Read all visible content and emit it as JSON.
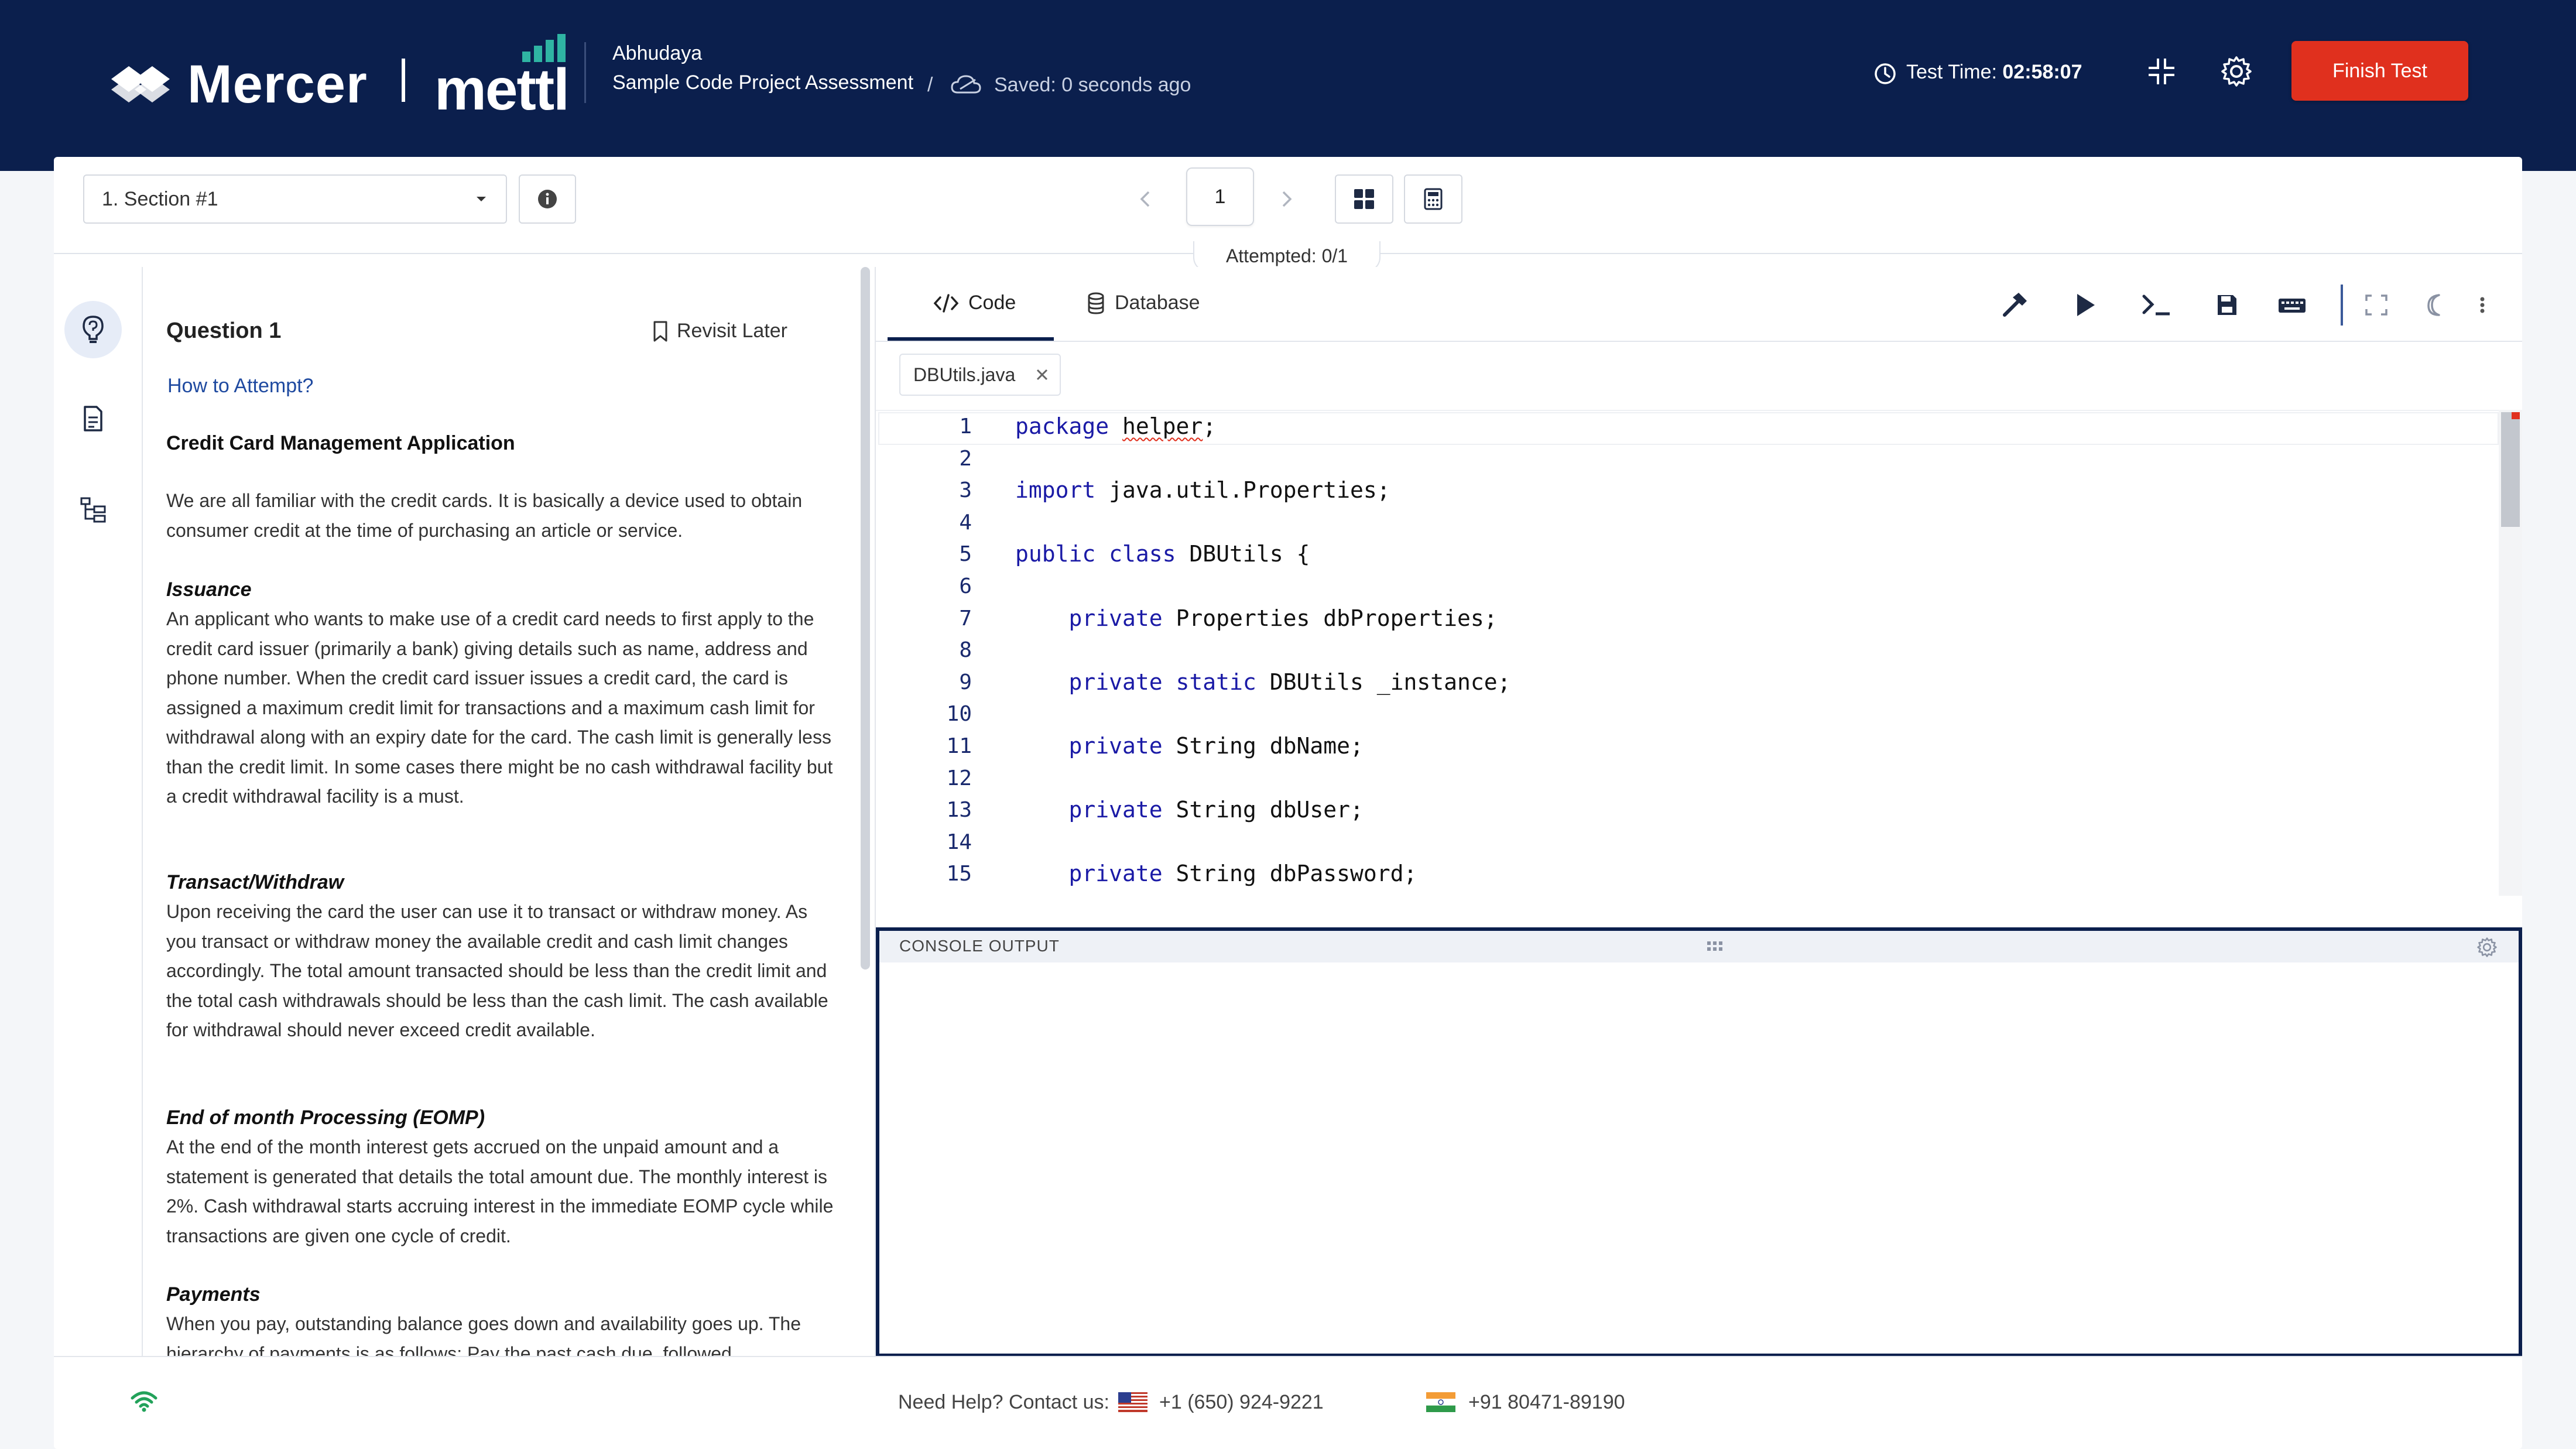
{
  "header": {
    "brand_mercer": "Mercer",
    "brand_mettl": "mettl",
    "user_name": "Abhudaya",
    "assessment_name": "Sample Code Project Assessment",
    "slash": "/",
    "saved_status": "Saved: 0 seconds ago",
    "test_time_label": "Test Time:",
    "test_time_value": "02:58:07",
    "finish_label": "Finish Test",
    "colors": {
      "header_bg": "#0b1f4d",
      "finish_bg": "#e0301e"
    }
  },
  "toolbar": {
    "section_selected": "1. Section #1",
    "question_number": "1",
    "attempted": "Attempted: 0/1"
  },
  "question": {
    "title": "Question 1",
    "revisit_label": "Revisit Later",
    "how_to_attempt": "How to Attempt?",
    "heading": "Credit Card Management Application",
    "intro": "We are all familiar with the credit cards. It is basically a device used to obtain consumer credit at the time of purchasing an article or service.",
    "sections": [
      {
        "title": "Issuance",
        "body": "An applicant who wants to make use of a credit card needs to first apply to the credit card issuer (primarily a bank) giving details such as name, address and phone number. When the credit card issuer issues a credit card, the card is assigned a maximum credit limit for transactions and a maximum cash limit for withdrawal along with an expiry date for the card. The cash limit is generally less than the credit limit. In some cases there might be no cash withdrawal facility but a credit withdrawal facility is a must."
      },
      {
        "title": "Transact/Withdraw",
        "body": "Upon receiving the card the user can use it to transact or withdraw money. As you transact or withdraw money the available credit and cash limit changes accordingly. The total amount transacted should be less than the credit limit and the total cash withdrawals should be less than the cash limit. The cash available for withdrawal should never exceed credit available."
      },
      {
        "title": "End of month Processing (EOMP)",
        "body": "At the end of the month interest gets accrued on the unpaid amount and a statement is generated that details the total amount due. The monthly interest is 2%. Cash withdrawal starts accruing interest in the immediate EOMP cycle while transactions are given one cycle of credit."
      },
      {
        "title": "Payments",
        "body": "When you pay, outstanding balance goes down and availability goes up. The hierarchy of payments is as follows: Pay the past cash due, followed"
      }
    ]
  },
  "editor": {
    "tabs": [
      {
        "label": "Code",
        "icon": "code-icon",
        "active": true
      },
      {
        "label": "Database",
        "icon": "database-icon",
        "active": false
      }
    ],
    "file_tab": "DBUtils.java",
    "lines": [
      {
        "n": "1",
        "kw": "package",
        "rest": " ",
        "err": "helper",
        "tail": ";"
      },
      {
        "n": "2",
        "kw": "",
        "rest": "",
        "err": "",
        "tail": ""
      },
      {
        "n": "3",
        "kw": "import",
        "rest": " java.util.Properties;",
        "err": "",
        "tail": ""
      },
      {
        "n": "4",
        "kw": "",
        "rest": "",
        "err": "",
        "tail": ""
      },
      {
        "n": "5",
        "kw": "public class",
        "rest": " DBUtils {",
        "err": "",
        "tail": ""
      },
      {
        "n": "6",
        "kw": "",
        "rest": "",
        "err": "",
        "tail": ""
      },
      {
        "n": "7",
        "kw": "    private",
        "rest": " Properties dbProperties;",
        "err": "",
        "tail": ""
      },
      {
        "n": "8",
        "kw": "",
        "rest": "",
        "err": "",
        "tail": ""
      },
      {
        "n": "9",
        "kw": "    private static",
        "rest": " DBUtils _instance;",
        "err": "",
        "tail": ""
      },
      {
        "n": "10",
        "kw": "",
        "rest": "",
        "err": "",
        "tail": ""
      },
      {
        "n": "11",
        "kw": "    private",
        "rest": " String dbName;",
        "err": "",
        "tail": ""
      },
      {
        "n": "12",
        "kw": "",
        "rest": "",
        "err": "",
        "tail": ""
      },
      {
        "n": "13",
        "kw": "    private",
        "rest": " String dbUser;",
        "err": "",
        "tail": ""
      },
      {
        "n": "14",
        "kw": "",
        "rest": "",
        "err": "",
        "tail": ""
      },
      {
        "n": "15",
        "kw": "    private",
        "rest": " String dbPassword;",
        "err": "",
        "tail": ""
      }
    ],
    "console_title": "CONSOLE OUTPUT"
  },
  "footer": {
    "help_text": "Need Help? Contact us:",
    "phone_us": "+1 (650) 924-9221",
    "phone_in": "+91 80471-89190"
  }
}
